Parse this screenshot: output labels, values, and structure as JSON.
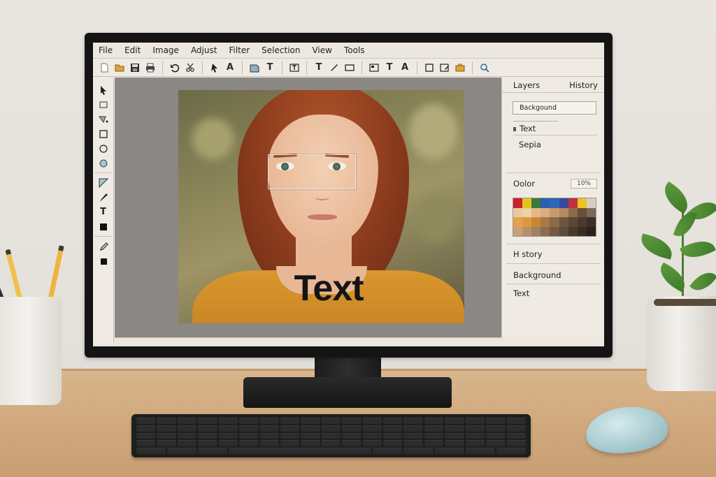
{
  "menu": [
    "File",
    "Edit",
    "Image",
    "Adjust",
    "Filter",
    "Selection",
    "View",
    "Tools"
  ],
  "toolbar": {
    "text_glyphs": [
      "A",
      "T",
      "T",
      "T",
      "T",
      "A"
    ]
  },
  "tools": {
    "text_glyph": "T"
  },
  "canvas": {
    "overlay_text": "Text"
  },
  "right_panel": {
    "tabs": [
      "Layers",
      "History"
    ],
    "layers": {
      "selected": "Backgound",
      "items": [
        "Text",
        "Sepia"
      ]
    },
    "color": {
      "label": "Oolor",
      "opacity": "10%"
    },
    "history": {
      "label": "H story",
      "items": [
        "Background",
        "Text"
      ]
    }
  },
  "palette": [
    "#c8202e",
    "#e6c21e",
    "#3a7b3a",
    "#2b5fb0",
    "#2d67b8",
    "#3a48a0",
    "#c03040",
    "#e8c428",
    "#d7cfc2",
    "#e9c9a2",
    "#f0d0a8",
    "#e2b887",
    "#d9ad7c",
    "#c99a6a",
    "#b48a5e",
    "#8d6a4a",
    "#6a4e38",
    "#7a6a55",
    "#e3a24b",
    "#dd9740",
    "#c98735",
    "#a77a4a",
    "#8a6a48",
    "#6e5440",
    "#5a4634",
    "#4a3a2c",
    "#3a3028",
    "#c7a07a",
    "#b3916f",
    "#a08060",
    "#8a6c50",
    "#735a44",
    "#5e4a38",
    "#4a3a2e",
    "#3a2e24",
    "#2a221c"
  ]
}
